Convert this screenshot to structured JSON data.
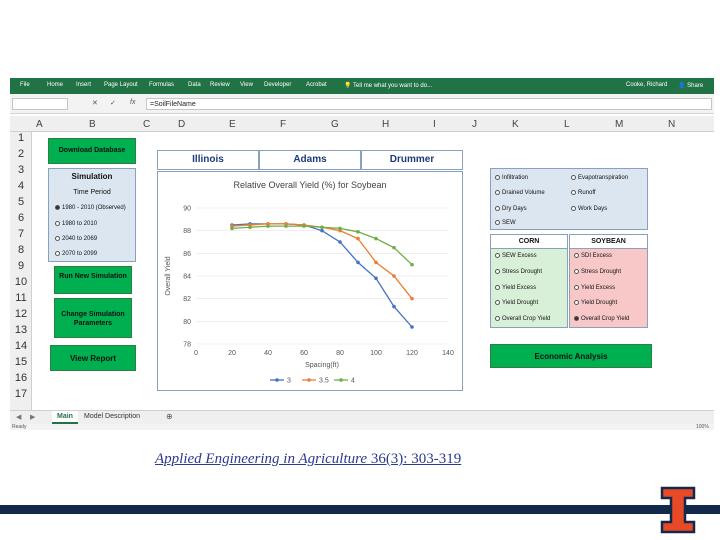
{
  "ribbon": {
    "tabs": [
      "File",
      "Home",
      "Insert",
      "Page Layout",
      "Formulas",
      "Data",
      "Review",
      "View",
      "Developer",
      "Acrobat"
    ],
    "tell_me": "Tell me what you want to do...",
    "user": "Cooke, Richard",
    "share": "Share"
  },
  "formula_bar": {
    "fx": "fx",
    "formula": "=SoilFileName"
  },
  "columns": [
    "A",
    "B",
    "C",
    "D",
    "E",
    "F",
    "G",
    "H",
    "I",
    "J",
    "K",
    "L",
    "M",
    "N"
  ],
  "rows": [
    "1",
    "2",
    "3",
    "4",
    "5",
    "6",
    "7",
    "8",
    "9",
    "10",
    "11",
    "12",
    "13",
    "14",
    "15",
    "16",
    "17"
  ],
  "left": {
    "download": "Download Database",
    "simulation_title": "Simulation",
    "time_period_title": "Time Period",
    "periods": [
      {
        "label": "1980 - 2010 (Observed)",
        "selected": true
      },
      {
        "label": "1980 to 2010",
        "selected": false
      },
      {
        "label": "2040 to 2069",
        "selected": false
      },
      {
        "label": "2070 to 2099",
        "selected": false
      }
    ],
    "run_new": "Run New Simulation",
    "change_params": "Change Simulation Parameters",
    "view_report": "View Report"
  },
  "location": {
    "state": "Illinois",
    "county": "Adams",
    "site": "Drummer"
  },
  "chart_data": {
    "type": "line",
    "title": "Relative Overall Yield (%) for Soybean",
    "xlabel": "Spacing(ft)",
    "ylabel": "Overall Yield",
    "xlim": [
      0,
      140
    ],
    "ylim": [
      78,
      90
    ],
    "xticks": [
      0,
      20,
      40,
      60,
      80,
      100,
      120,
      140
    ],
    "yticks": [
      78,
      80,
      82,
      84,
      86,
      88,
      90
    ],
    "grid": true,
    "legend": "bottom",
    "series": [
      {
        "name": "3",
        "color": "#4472c4",
        "x": [
          20,
          30,
          40,
          50,
          60,
          70,
          80,
          90,
          100,
          110,
          120
        ],
        "y": [
          88.5,
          88.6,
          88.6,
          88.6,
          88.5,
          88.0,
          87.0,
          85.2,
          83.8,
          81.3,
          79.5
        ]
      },
      {
        "name": "3.5",
        "color": "#ed7d31",
        "x": [
          20,
          30,
          40,
          50,
          60,
          70,
          80,
          90,
          100,
          110,
          120
        ],
        "y": [
          88.4,
          88.5,
          88.6,
          88.6,
          88.5,
          88.3,
          88.0,
          87.3,
          85.2,
          84.0,
          82.0
        ]
      },
      {
        "name": "4",
        "color": "#70ad47",
        "x": [
          20,
          30,
          40,
          50,
          60,
          70,
          80,
          90,
          100,
          110,
          120
        ],
        "y": [
          88.2,
          88.3,
          88.4,
          88.4,
          88.4,
          88.3,
          88.2,
          87.9,
          87.3,
          86.5,
          85.0
        ]
      }
    ]
  },
  "options": [
    {
      "label": "Infiltration",
      "selected": false
    },
    {
      "label": "Evapotranspiration",
      "selected": false
    },
    {
      "label": "Drained Volume",
      "selected": false
    },
    {
      "label": "Runoff",
      "selected": false
    },
    {
      "label": "Dry Days",
      "selected": false
    },
    {
      "label": "Work Days",
      "selected": false
    },
    {
      "label": "SEW",
      "selected": false
    }
  ],
  "corn": {
    "title": "CORN",
    "items": [
      {
        "label": "SEW Excess",
        "selected": false
      },
      {
        "label": "Stress Drought",
        "selected": false
      },
      {
        "label": "Yield Excess",
        "selected": false
      },
      {
        "label": "Yield Drought",
        "selected": false
      },
      {
        "label": "Overall Crop Yield",
        "selected": false
      }
    ]
  },
  "soybean": {
    "title": "SOYBEAN",
    "items": [
      {
        "label": "SDI Excess",
        "selected": false
      },
      {
        "label": "Stress Drought",
        "selected": false
      },
      {
        "label": "Yield Excess",
        "selected": false
      },
      {
        "label": "Yield Drought",
        "selected": false
      },
      {
        "label": "Overall Crop Yield",
        "selected": true
      }
    ]
  },
  "economic": "Economic Analysis",
  "sheets": {
    "main": "Main",
    "model_description": "Model Description",
    "add": "⊕"
  },
  "status": {
    "ready": "Ready",
    "zoom": "100%"
  },
  "citation": {
    "journal": "Applied Engineering in Agriculture",
    "ref": " 36(3): 303-319"
  },
  "colors": {
    "excel_green": "#217346",
    "illinois_orange": "#e84a27",
    "illinois_blue": "#13294b",
    "link_blue": "#2b3990"
  }
}
